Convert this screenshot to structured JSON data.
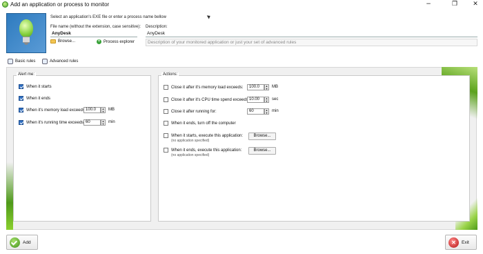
{
  "window": {
    "title": "Add an application or process to monitor",
    "minimize": "−",
    "maximize": "❐",
    "close": "✕"
  },
  "header": {
    "instruction": "Select an application's EXE file or enter a process name bellow",
    "file_name_label": "File name (without the extension, case sensitive):",
    "file_name_value": "AnyDesk",
    "browse_label": "Browse...",
    "process_explorer_label": "Process explorer",
    "description_label": "Description:",
    "description_value": "AnyDesk",
    "description_placeholder": "Description of your monitored application or just your set of advanced rules"
  },
  "tabs": [
    {
      "label": "Basic rules",
      "icon": "basic-rules-icon",
      "active": true
    },
    {
      "label": "Advanced rules",
      "icon": "advanced-rules-icon",
      "active": false
    }
  ],
  "alert": {
    "title": "Alert me:",
    "items": [
      {
        "label": "When it starts",
        "checked": true
      },
      {
        "label": "When it ends",
        "checked": true
      },
      {
        "label": "When it's memory load exceeds:",
        "checked": true,
        "value": "100.0",
        "unit": "MB"
      },
      {
        "label": "When it's running time exceeds:",
        "checked": true,
        "value": "60",
        "unit": "min"
      }
    ]
  },
  "actions": {
    "title": "Actions:",
    "items": [
      {
        "label": "Close it after it's memory load exceeds:",
        "checked": false,
        "value": "100.0",
        "unit": "MB"
      },
      {
        "label": "Close it after it's CPU time spend exceeds:",
        "checked": false,
        "value": "10.00",
        "unit": "sec"
      },
      {
        "label": "Close it after running for:",
        "checked": false,
        "value": "60",
        "unit": "min"
      },
      {
        "label": "When it ends, turn off the computer",
        "checked": false
      },
      {
        "label": "When it starts, execute this application:",
        "checked": false,
        "sub": "(no application specified)",
        "button": "Browse..."
      },
      {
        "label": "When it ends, execute this application:",
        "checked": false,
        "sub": "(no application specified)",
        "button": "Browse..."
      }
    ]
  },
  "buttons": {
    "add": "Add",
    "exit": "Exit"
  },
  "colors": {
    "accent_green": "#5ba21c",
    "checkbox_blue": "#2f6fc2",
    "icon_blue": "#2e7bbf"
  }
}
